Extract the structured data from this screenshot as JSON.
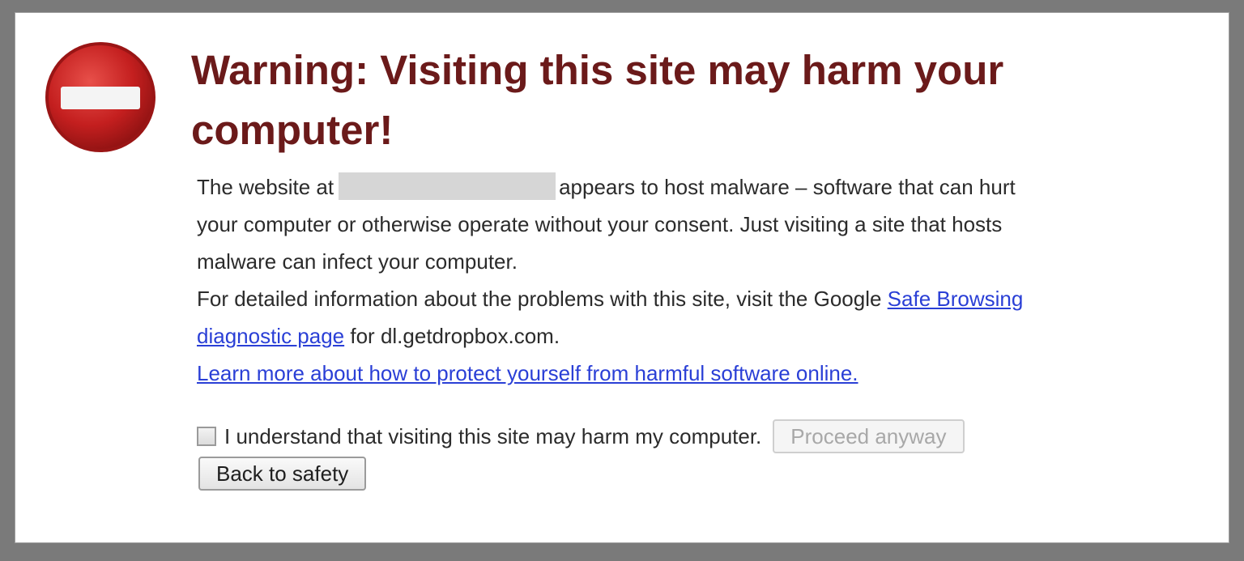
{
  "warning": {
    "title": "Warning: Visiting this site may harm your computer!",
    "icon": "stop-icon"
  },
  "body": {
    "para1_before": "The website at",
    "para1_after": "appears to host malware – software that can hurt your computer or otherwise operate without your consent. Just visiting a site that hosts malware can infect your computer.",
    "para2_before": "For detailed information about the problems with this site, visit the Google",
    "diagnostic_link": "Safe Browsing diagnostic page",
    "para2_after": "for dl.getdropbox.com.",
    "learn_more_link": "Learn more about how to protect yourself from harmful software online."
  },
  "confirm": {
    "checkbox_label": "I understand that visiting this site may harm my computer.",
    "checked": false
  },
  "buttons": {
    "proceed_label": "Proceed anyway",
    "back_label": "Back to safety"
  },
  "colors": {
    "title": "#6b1a1a",
    "link": "#2a3fd6",
    "stop_icon": "#c41f1f",
    "frame_background": "#7a7a7a"
  }
}
